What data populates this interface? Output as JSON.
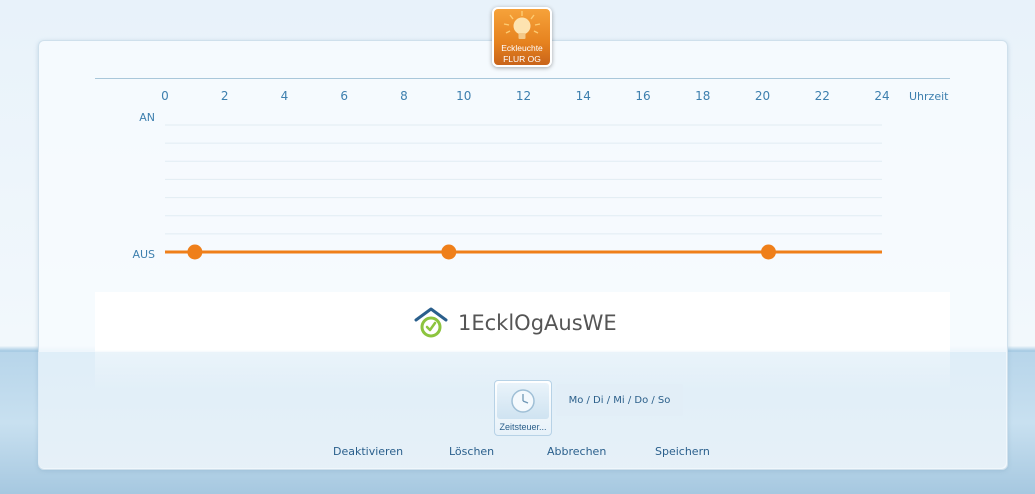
{
  "device": {
    "name_line1": "Eckleuchte",
    "name_line2": "FLUR OG",
    "icon": "lightbulb-icon",
    "color": "#e8821f"
  },
  "chart_data": {
    "type": "line",
    "xlabel": "Uhrzeit",
    "x_ticks": [
      0,
      2,
      4,
      6,
      8,
      10,
      12,
      14,
      16,
      18,
      20,
      22,
      24
    ],
    "xlim": [
      0,
      24
    ],
    "y_levels": [
      "AN",
      "AUS"
    ],
    "series": [
      {
        "values": "AUS",
        "color": "#ef7f1a",
        "points": [
          {
            "x": 1.0,
            "y": "AUS"
          },
          {
            "x": 9.5,
            "y": "AUS"
          },
          {
            "x": 20.2,
            "y": "AUS"
          }
        ]
      }
    ],
    "grid": true
  },
  "schedule": {
    "name": "1EcklOgAusWE",
    "icon": "home-clock-icon"
  },
  "timer": {
    "label": "Zeitsteuer...",
    "icon": "clock-icon"
  },
  "days": "Mo / Di / Mi / Do / So",
  "actions": {
    "deactivate": "Deaktivieren",
    "delete": "Löschen",
    "cancel": "Abbrechen",
    "save": "Speichern"
  }
}
